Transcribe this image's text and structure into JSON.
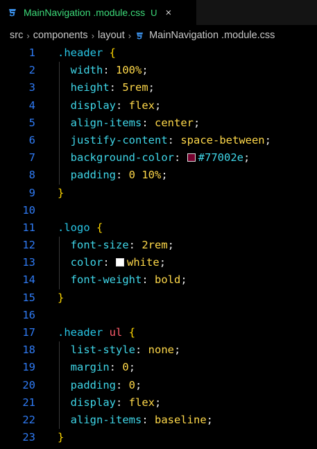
{
  "tab": {
    "title": "MainNavigation .module.css",
    "status": "U",
    "close": "×",
    "icon": "css-file-icon"
  },
  "breadcrumb": {
    "items": [
      "src",
      "components",
      "layout",
      "MainNavigation .module.css"
    ],
    "separator": "›"
  },
  "colors": {
    "line_number": "#2f7bf5",
    "selector": "#28c6e6",
    "tag": "#ff5c6c",
    "brace": "#ffd700",
    "property": "#3fd6e8",
    "value": "#ffd94a",
    "tab_title": "#3ddb7a"
  },
  "code": {
    "lines": [
      {
        "n": "1",
        "tokens": [
          [
            "selector",
            ".header"
          ],
          [
            "punct",
            " "
          ],
          [
            "brace",
            "{"
          ]
        ]
      },
      {
        "n": "2",
        "tokens": [
          [
            "prop",
            "width"
          ],
          [
            "punct",
            ": "
          ],
          [
            "value",
            "100%"
          ],
          [
            "punct",
            ";"
          ]
        ]
      },
      {
        "n": "3",
        "tokens": [
          [
            "prop",
            "height"
          ],
          [
            "punct",
            ": "
          ],
          [
            "value",
            "5rem"
          ],
          [
            "punct",
            ";"
          ]
        ]
      },
      {
        "n": "4",
        "tokens": [
          [
            "prop",
            "display"
          ],
          [
            "punct",
            ": "
          ],
          [
            "value",
            "flex"
          ],
          [
            "punct",
            ";"
          ]
        ]
      },
      {
        "n": "5",
        "tokens": [
          [
            "prop",
            "align-items"
          ],
          [
            "punct",
            ": "
          ],
          [
            "value",
            "center"
          ],
          [
            "punct",
            ";"
          ]
        ]
      },
      {
        "n": "6",
        "tokens": [
          [
            "prop",
            "justify-content"
          ],
          [
            "punct",
            ": "
          ],
          [
            "value",
            "space-between"
          ],
          [
            "punct",
            ";"
          ]
        ]
      },
      {
        "n": "7",
        "tokens": [
          [
            "prop",
            "background-color"
          ],
          [
            "punct",
            ": "
          ],
          [
            "swatch",
            "#77002e"
          ],
          [
            "hex",
            "#77002e"
          ],
          [
            "punct",
            ";"
          ]
        ]
      },
      {
        "n": "8",
        "tokens": [
          [
            "prop",
            "padding"
          ],
          [
            "punct",
            ": "
          ],
          [
            "value",
            "0 10%"
          ],
          [
            "punct",
            ";"
          ]
        ]
      },
      {
        "n": "9",
        "tokens": [
          [
            "brace",
            "}"
          ]
        ]
      },
      {
        "n": "10",
        "tokens": []
      },
      {
        "n": "11",
        "tokens": [
          [
            "selector",
            ".logo"
          ],
          [
            "punct",
            " "
          ],
          [
            "brace",
            "{"
          ]
        ]
      },
      {
        "n": "12",
        "tokens": [
          [
            "prop",
            "font-size"
          ],
          [
            "punct",
            ": "
          ],
          [
            "value",
            "2rem"
          ],
          [
            "punct",
            ";"
          ]
        ]
      },
      {
        "n": "13",
        "tokens": [
          [
            "prop",
            "color"
          ],
          [
            "punct",
            ": "
          ],
          [
            "swatch",
            "#ffffff"
          ],
          [
            "value",
            "white"
          ],
          [
            "punct",
            ";"
          ]
        ]
      },
      {
        "n": "14",
        "tokens": [
          [
            "prop",
            "font-weight"
          ],
          [
            "punct",
            ": "
          ],
          [
            "value",
            "bold"
          ],
          [
            "punct",
            ";"
          ]
        ]
      },
      {
        "n": "15",
        "tokens": [
          [
            "brace",
            "}"
          ]
        ]
      },
      {
        "n": "16",
        "tokens": []
      },
      {
        "n": "17",
        "tokens": [
          [
            "selector",
            ".header"
          ],
          [
            "punct",
            " "
          ],
          [
            "tag",
            "ul"
          ],
          [
            "punct",
            " "
          ],
          [
            "brace",
            "{"
          ]
        ]
      },
      {
        "n": "18",
        "tokens": [
          [
            "prop",
            "list-style"
          ],
          [
            "punct",
            ": "
          ],
          [
            "value",
            "none"
          ],
          [
            "punct",
            ";"
          ]
        ]
      },
      {
        "n": "19",
        "tokens": [
          [
            "prop",
            "margin"
          ],
          [
            "punct",
            ": "
          ],
          [
            "value",
            "0"
          ],
          [
            "punct",
            ";"
          ]
        ]
      },
      {
        "n": "20",
        "tokens": [
          [
            "prop",
            "padding"
          ],
          [
            "punct",
            ": "
          ],
          [
            "value",
            "0"
          ],
          [
            "punct",
            ";"
          ]
        ]
      },
      {
        "n": "21",
        "tokens": [
          [
            "prop",
            "display"
          ],
          [
            "punct",
            ": "
          ],
          [
            "value",
            "flex"
          ],
          [
            "punct",
            ";"
          ]
        ]
      },
      {
        "n": "22",
        "tokens": [
          [
            "prop",
            "align-items"
          ],
          [
            "punct",
            ": "
          ],
          [
            "value",
            "baseline"
          ],
          [
            "punct",
            ";"
          ]
        ]
      },
      {
        "n": "23",
        "tokens": [
          [
            "brace",
            "}"
          ]
        ]
      }
    ]
  }
}
